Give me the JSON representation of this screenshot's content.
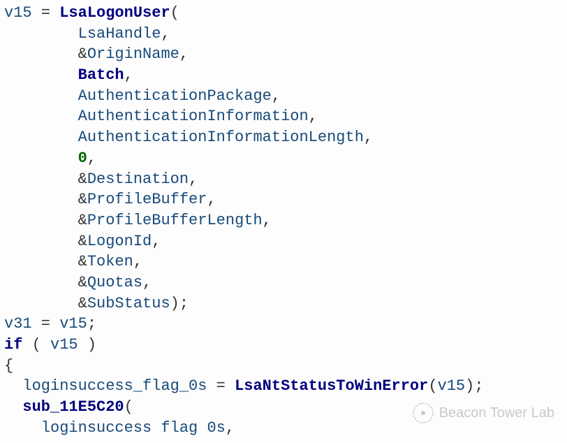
{
  "code": {
    "line1": {
      "var": "v15",
      "assign": " = ",
      "func": "LsaLogonUser",
      "open": "("
    },
    "args": [
      {
        "kind": "var",
        "text": "LsaHandle"
      },
      {
        "kind": "ref",
        "text": "OriginName"
      },
      {
        "kind": "bold",
        "text": "Batch"
      },
      {
        "kind": "var",
        "text": "AuthenticationPackage"
      },
      {
        "kind": "var",
        "text": "AuthenticationInformation"
      },
      {
        "kind": "var",
        "text": "AuthenticationInformationLength"
      },
      {
        "kind": "num",
        "text": "0"
      },
      {
        "kind": "ref",
        "text": "Destination"
      },
      {
        "kind": "ref",
        "text": "ProfileBuffer"
      },
      {
        "kind": "ref",
        "text": "ProfileBufferLength"
      },
      {
        "kind": "ref",
        "text": "LogonId"
      },
      {
        "kind": "ref",
        "text": "Token"
      },
      {
        "kind": "ref",
        "text": "Quotas"
      },
      {
        "kind": "ref",
        "text": "SubStatus",
        "close": ");"
      }
    ],
    "line16": {
      "lhs": "v31",
      "assign": " = ",
      "rhs": "v15",
      "semi": ";"
    },
    "line17": {
      "kw": "if",
      "open": " ( ",
      "var": "v15",
      "close": " )"
    },
    "line18": {
      "brace": "{"
    },
    "line19": {
      "lhs": "loginsuccess_flag_0s",
      "assign": " = ",
      "func": "LsaNtStatusToWinError",
      "open": "(",
      "arg": "v15",
      "close": ");"
    },
    "line20": {
      "func": "sub_11E5C20",
      "open": "("
    },
    "line21": {
      "arg": "loginsuccess flag 0s",
      "comma": ","
    }
  },
  "watermark": {
    "text": "Beacon Tower Lab"
  },
  "colors": {
    "identifier": "#184a7a",
    "function": "#000080",
    "number": "#006400",
    "background": "#fdfdfd"
  }
}
